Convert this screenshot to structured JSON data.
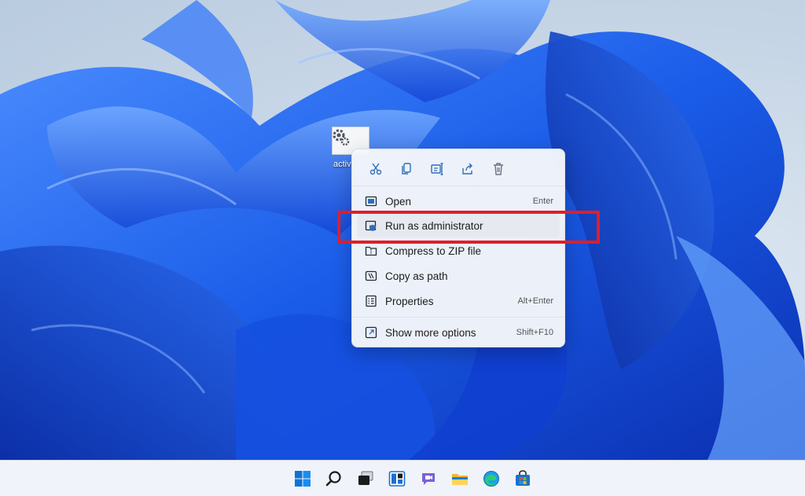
{
  "desktop": {
    "icon_label": "activ",
    "icon": "settings-file-icon"
  },
  "context_menu": {
    "quick_actions": [
      {
        "name": "cut-icon"
      },
      {
        "name": "copy-icon"
      },
      {
        "name": "rename-icon"
      },
      {
        "name": "share-icon"
      },
      {
        "name": "delete-icon"
      }
    ],
    "items": [
      {
        "label": "Open",
        "shortcut": "Enter",
        "icon": "open-icon"
      },
      {
        "label": "Run as administrator",
        "shortcut": "",
        "icon": "shield-icon"
      },
      {
        "label": "Compress to ZIP file",
        "shortcut": "",
        "icon": "zip-icon"
      },
      {
        "label": "Copy as path",
        "shortcut": "",
        "icon": "copy-path-icon"
      },
      {
        "label": "Properties",
        "shortcut": "Alt+Enter",
        "icon": "properties-icon"
      },
      {
        "label": "Show more options",
        "shortcut": "Shift+F10",
        "icon": "more-options-icon"
      }
    ]
  },
  "annotation": {
    "color": "#e01e29"
  },
  "taskbar": {
    "icons": [
      "windows-start-icon",
      "search-icon",
      "task-view-icon",
      "widgets-icon",
      "chat-icon",
      "file-explorer-icon",
      "edge-icon",
      "store-icon"
    ]
  },
  "colors": {
    "wallpaper_primary": "#1a5ce8",
    "accent": "#0067c0"
  }
}
